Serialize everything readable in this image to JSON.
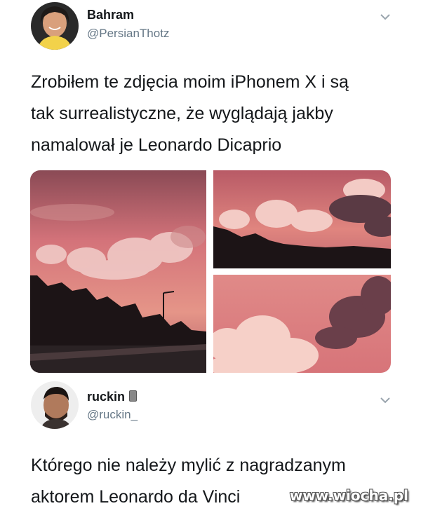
{
  "tweets": [
    {
      "name": "Bahram",
      "handle": "@PersianThotz",
      "text_lines": [
        "Zrobiłem te zdjęcia moim iPhonem X i są",
        "tak surrealistyczne, że wyglądają jakby",
        "namalował je Leonardo Dicaprio"
      ]
    },
    {
      "name": "ruckin",
      "handle": "@ruckin_",
      "text_lines": [
        "Którego nie należy mylić z nagradzanym",
        "aktorem Leonardo da Vinci"
      ]
    }
  ],
  "watermark": "www.wiocha.pl",
  "icons": {
    "more": "chevron-down-icon",
    "badge": "phone-icon"
  },
  "colors": {
    "text": "#14171a",
    "secondary": "#657786",
    "sky_pink": "#d9707a",
    "cloud": "#f2c7c4",
    "silhouette": "#1c1416"
  }
}
